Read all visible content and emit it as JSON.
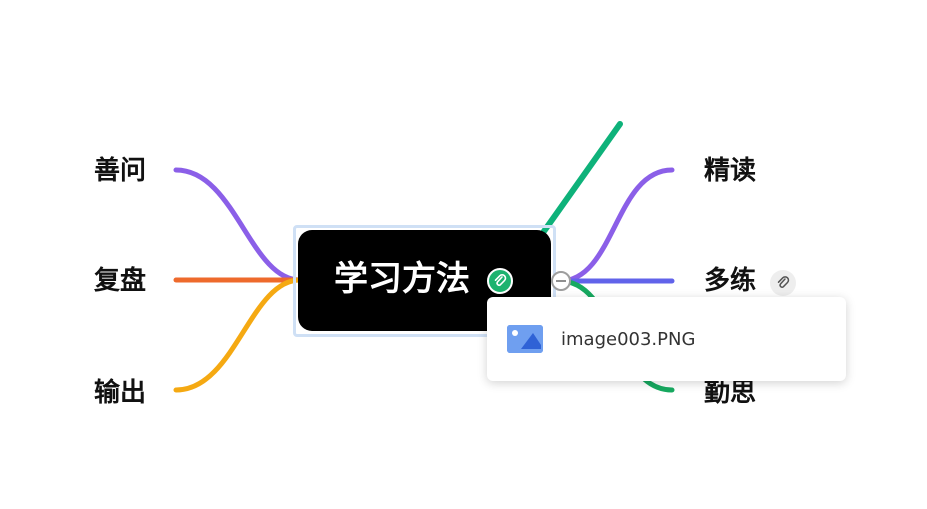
{
  "root": {
    "label": "学习方法",
    "attachment_icon": "paperclip-icon"
  },
  "left_branches": [
    {
      "label": "善问",
      "color": "#8b5fe8"
    },
    {
      "label": "复盘",
      "color": "#ee6a2c"
    },
    {
      "label": "输出",
      "color": "#f5a912"
    }
  ],
  "right_branches": [
    {
      "label": "精读",
      "color": "#8b5fe8"
    },
    {
      "label": "多练",
      "color": "#6163ea",
      "attachment_icon": "paperclip-icon"
    },
    {
      "label": "勤思",
      "color": "#17a960"
    }
  ],
  "attachment_popup": {
    "file_name": "image003.PNG",
    "file_icon": "image-file-icon"
  },
  "annotation_arrow_color": "#0eb27a",
  "selection_color": "#cfe0f5"
}
